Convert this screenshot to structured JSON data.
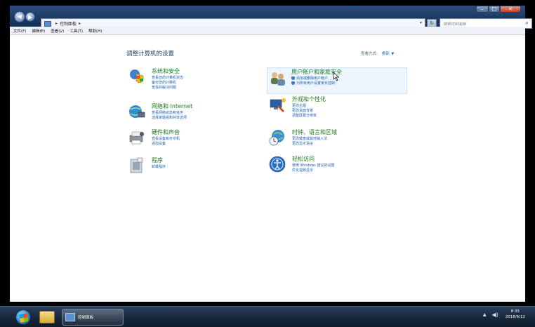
{
  "window": {
    "address_path": "控制面板",
    "search_placeholder": "搜索控制面板"
  },
  "menu": [
    "文件(F)",
    "编辑(E)",
    "查看(V)",
    "工具(T)",
    "帮助(H)"
  ],
  "main": {
    "title": "调整计算机的设置",
    "view_by_label": "查看方式:",
    "view_by_value": "类别"
  },
  "categories": [
    {
      "title": "系统和安全",
      "links": [
        "查看您的计算机状态",
        "备份您的计算机",
        "查找并解决问题"
      ]
    },
    {
      "title": "网络和 Internet",
      "links": [
        "查看网络状态和任务",
        "选择家庭组和共享选项"
      ]
    },
    {
      "title": "硬件和声音",
      "links": [
        "查看设备和打印机",
        "添加设备"
      ]
    },
    {
      "title": "程序",
      "links": [
        "卸载程序"
      ]
    },
    {
      "title": "用户帐户和家庭安全",
      "links": [
        "添加或删除用户帐户",
        "为所有用户设置家长控制"
      ]
    },
    {
      "title": "外观和个性化",
      "links": [
        "更改主题",
        "更改桌面背景",
        "调整屏幕分辨率"
      ]
    },
    {
      "title": "时钟、语言和区域",
      "links": [
        "更改键盘或其他输入法",
        "更改显示语言"
      ]
    },
    {
      "title": "轻松访问",
      "links": [
        "使用 Windows 建议的设置",
        "优化视频显示"
      ]
    }
  ],
  "taskbar": {
    "task_label": "控制面板",
    "time": "8:35",
    "date": "2018/6/12"
  }
}
